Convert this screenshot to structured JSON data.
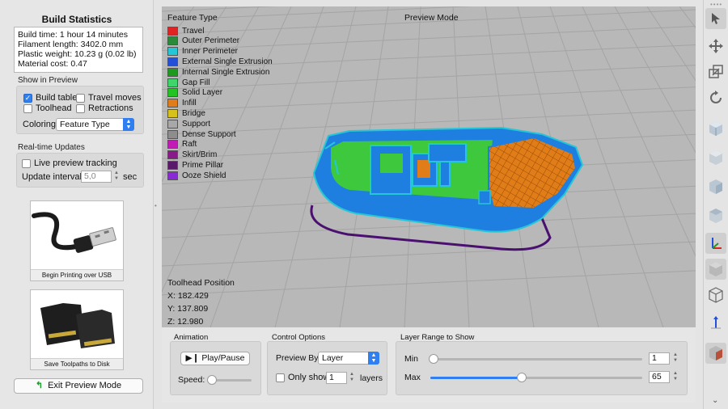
{
  "build_stats": {
    "title": "Build Statistics",
    "lines": [
      "Build time: 1 hour 14 minutes",
      "Filament length: 3402.0 mm",
      "Plastic weight: 10.23 g (0.02 lb)",
      "Material cost: 0.47"
    ]
  },
  "show_in_preview": {
    "label": "Show in Preview",
    "build_table": {
      "label": "Build table",
      "checked": true
    },
    "travel_moves": {
      "label": "Travel moves",
      "checked": false
    },
    "toolhead": {
      "label": "Toolhead",
      "checked": false
    },
    "retractions": {
      "label": "Retractions",
      "checked": false
    },
    "coloring_label": "Coloring",
    "coloring_value": "Feature Type"
  },
  "realtime": {
    "label": "Real-time Updates",
    "live_tracking": {
      "label": "Live preview tracking",
      "checked": false
    },
    "interval_label": "Update interval",
    "interval_value": "5,0",
    "interval_unit": "sec"
  },
  "cards": {
    "usb_caption": "Begin Printing over USB",
    "sd_caption": "Save Toolpaths to Disk"
  },
  "exit_label": "Exit Preview Mode",
  "viewport": {
    "legend_title": "Feature Type",
    "mode_label": "Preview Mode",
    "legend": [
      {
        "label": "Travel",
        "color": "#e02424"
      },
      {
        "label": "Outer Perimeter",
        "color": "#2a8a3a"
      },
      {
        "label": "Inner Perimeter",
        "color": "#25c6d6"
      },
      {
        "label": "External Single Extrusion",
        "color": "#2450d8"
      },
      {
        "label": "Internal Single Extrusion",
        "color": "#1e9a1e"
      },
      {
        "label": "Gap Fill",
        "color": "#3ed66a"
      },
      {
        "label": "Solid Layer",
        "color": "#22c322"
      },
      {
        "label": "Infill",
        "color": "#e07d18"
      },
      {
        "label": "Bridge",
        "color": "#d6c21a"
      },
      {
        "label": "Support",
        "color": "#a8a8a8"
      },
      {
        "label": "Dense Support",
        "color": "#8d8d8d"
      },
      {
        "label": "Raft",
        "color": "#c21ab4"
      },
      {
        "label": "Skirt/Brim",
        "color": "#8a1a8a"
      },
      {
        "label": "Prime Pillar",
        "color": "#5a1a6a"
      },
      {
        "label": "Ooze Shield",
        "color": "#8a2ad4"
      }
    ],
    "toolhead_title": "Toolhead Position",
    "x": "X: 182.429",
    "y": "Y: 137.809",
    "z": "Z: 12.980"
  },
  "animation": {
    "label": "Animation",
    "play_label": "Play/Pause",
    "speed_label": "Speed:",
    "speed_fraction": 0.05
  },
  "control_options": {
    "label": "Control Options",
    "preview_by_label": "Preview By",
    "preview_by_value": "Layer",
    "only_show_label": "Only show",
    "only_show_value": "1",
    "layers_label": "layers",
    "only_show_checked": false
  },
  "layer_range": {
    "label": "Layer Range to Show",
    "min_label": "Min",
    "max_label": "Max",
    "min_value": "1",
    "max_value": "65",
    "min_fraction": 0.0,
    "max_fraction": 0.43
  },
  "colors": {
    "accent": "#2f7ff0",
    "hull": "#1e7fe0",
    "deck": "#3ec83e",
    "infill": "#e07d18",
    "viewport_bg": "#b8b8b8"
  }
}
